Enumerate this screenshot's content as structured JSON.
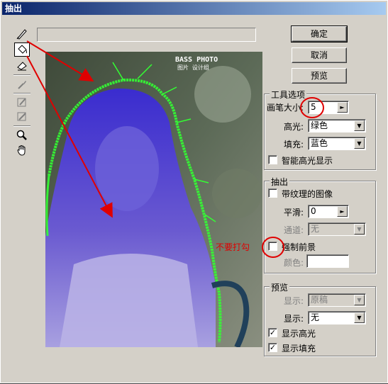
{
  "window": {
    "title": "抽出"
  },
  "tools": [
    {
      "name": "edge-highlighter-tool"
    },
    {
      "name": "fill-tool"
    },
    {
      "name": "eraser-tool"
    },
    {
      "name": "eyedropper-tool"
    },
    {
      "name": "cleanup-tool"
    },
    {
      "name": "edge-touchup-tool"
    },
    {
      "name": "zoom-tool"
    },
    {
      "name": "hand-tool"
    }
  ],
  "preview_image": {
    "watermark_line1": "BASS PHOTO",
    "watermark_line2": "图片  设计组"
  },
  "buttons": {
    "ok": "确定",
    "cancel": "取消",
    "preview": "预览"
  },
  "tool_options": {
    "title": "工具选项",
    "brush_size_label": "画笔大小:",
    "brush_size_value": "5",
    "highlight_label": "高光:",
    "highlight_value": "绿色",
    "fill_label": "填充:",
    "fill_value": "蓝色",
    "smart_highlight_label": "智能高光显示"
  },
  "extraction": {
    "title": "抽出",
    "textured_image_label": "带纹理的图像",
    "smooth_label": "平滑:",
    "smooth_value": "0",
    "channel_label": "通道:",
    "channel_value": "无",
    "force_foreground_label": "强制前景",
    "color_label": "颜色:"
  },
  "preview": {
    "title": "预览",
    "show_label_1": "显示:",
    "show_value_1": "原稿",
    "show_label_2": "显示:",
    "show_value_2": "无",
    "show_highlight_label": "显示高光",
    "show_fill_label": "显示填充"
  },
  "annotation": {
    "note": "不要打勾"
  },
  "colors": {
    "annotation_red": "#e00000",
    "highlight_green": "#33ff33",
    "fill_blue": "#2222cc"
  }
}
